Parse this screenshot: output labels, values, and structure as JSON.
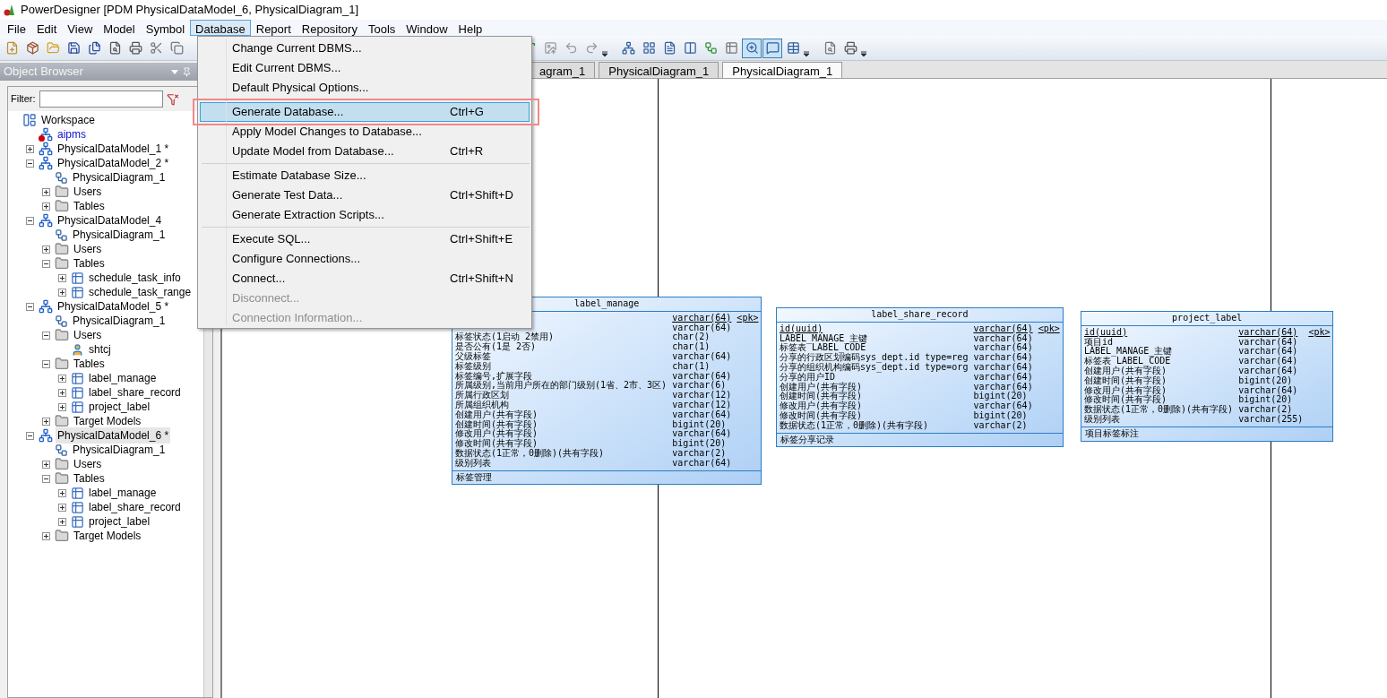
{
  "window": {
    "title": "PowerDesigner [PDM PhysicalDataModel_6, PhysicalDiagram_1]"
  },
  "menu_bar": [
    {
      "label": "File",
      "selected": false
    },
    {
      "label": "Edit",
      "selected": false
    },
    {
      "label": "View",
      "selected": false
    },
    {
      "label": "Model",
      "selected": false
    },
    {
      "label": "Symbol",
      "selected": false
    },
    {
      "label": "Database",
      "selected": true
    },
    {
      "label": "Report",
      "selected": false
    },
    {
      "label": "Repository",
      "selected": false
    },
    {
      "label": "Tools",
      "selected": false
    },
    {
      "label": "Window",
      "selected": false
    },
    {
      "label": "Help",
      "selected": false
    }
  ],
  "database_menu": [
    {
      "kind": "item",
      "label": "Change Current DBMS...",
      "disabled": false,
      "selected": false
    },
    {
      "kind": "item",
      "label": "Edit Current DBMS...",
      "disabled": false,
      "selected": false
    },
    {
      "kind": "item",
      "label": "Default Physical Options...",
      "disabled": false,
      "selected": false
    },
    {
      "kind": "separator"
    },
    {
      "kind": "item",
      "label": "Generate Database...",
      "shortcut": "Ctrl+G",
      "disabled": false,
      "selected": true
    },
    {
      "kind": "item",
      "label": "Apply Model Changes to Database...",
      "disabled": false,
      "selected": false
    },
    {
      "kind": "item",
      "label": "Update Model from Database...",
      "shortcut": "Ctrl+R",
      "disabled": false,
      "selected": false
    },
    {
      "kind": "separator"
    },
    {
      "kind": "item",
      "label": "Estimate Database Size...",
      "disabled": false,
      "selected": false
    },
    {
      "kind": "item",
      "label": "Generate Test Data...",
      "shortcut": "Ctrl+Shift+D",
      "disabled": false,
      "selected": false
    },
    {
      "kind": "item",
      "label": "Generate Extraction Scripts...",
      "disabled": false,
      "selected": false
    },
    {
      "kind": "separator"
    },
    {
      "kind": "item",
      "label": "Execute SQL...",
      "shortcut": "Ctrl+Shift+E",
      "disabled": false,
      "selected": false
    },
    {
      "kind": "item",
      "label": "Configure Connections...",
      "disabled": false,
      "selected": false
    },
    {
      "kind": "item",
      "label": "Connect...",
      "shortcut": "Ctrl+Shift+N",
      "disabled": false,
      "selected": false
    },
    {
      "kind": "item",
      "label": "Disconnect...",
      "disabled": true,
      "selected": false
    },
    {
      "kind": "item",
      "label": "Connection Information...",
      "disabled": true,
      "selected": false
    }
  ],
  "object_browser": {
    "title": "Object Browser",
    "filter_label": "Filter:",
    "tree": [
      {
        "label": "Workspace",
        "kind": "workspace",
        "selected": false,
        "children": [
          {
            "label": "aipms",
            "kind": "closed_model",
            "selected": false
          },
          {
            "label": "PhysicalDataModel_1 *",
            "kind": "model",
            "selected": false,
            "expanded": false
          },
          {
            "label": "PhysicalDataModel_2 *",
            "kind": "model",
            "selected": false,
            "expanded": true,
            "children": [
              {
                "label": "PhysicalDiagram_1",
                "kind": "diagram",
                "selected": false
              },
              {
                "label": "Users",
                "kind": "folder",
                "selected": false,
                "expanded": false
              },
              {
                "label": "Tables",
                "kind": "folder",
                "selected": false,
                "expanded": false
              }
            ]
          },
          {
            "label": "PhysicalDataModel_4",
            "kind": "model",
            "selected": false,
            "expanded": true,
            "children": [
              {
                "label": "PhysicalDiagram_1",
                "kind": "diagram",
                "selected": false
              },
              {
                "label": "Users",
                "kind": "folder",
                "selected": false,
                "expanded": false
              },
              {
                "label": "Tables",
                "kind": "folder",
                "selected": false,
                "expanded": true,
                "children": [
                  {
                    "label": "schedule_task_info",
                    "kind": "table",
                    "selected": false,
                    "expanded": false
                  },
                  {
                    "label": "schedule_task_range",
                    "kind": "table",
                    "selected": false,
                    "expanded": false
                  }
                ]
              }
            ]
          },
          {
            "label": "PhysicalDataModel_5 *",
            "kind": "model",
            "selected": false,
            "expanded": true,
            "children": [
              {
                "label": "PhysicalDiagram_1",
                "kind": "diagram",
                "selected": false
              },
              {
                "label": "Users",
                "kind": "folder",
                "selected": false,
                "expanded": true,
                "children": [
                  {
                    "label": "shtcj",
                    "kind": "user",
                    "selected": false
                  }
                ]
              },
              {
                "label": "Tables",
                "kind": "folder",
                "selected": false,
                "expanded": true,
                "children": [
                  {
                    "label": "label_manage",
                    "kind": "table",
                    "selected": false,
                    "expanded": false
                  },
                  {
                    "label": "label_share_record",
                    "kind": "table",
                    "selected": false,
                    "expanded": false
                  },
                  {
                    "label": "project_label",
                    "kind": "table",
                    "selected": false,
                    "expanded": false
                  }
                ]
              },
              {
                "label": "Target Models",
                "kind": "folder",
                "selected": false,
                "expanded": false
              }
            ]
          },
          {
            "label": "PhysicalDataModel_6 *",
            "kind": "model",
            "selected": true,
            "expanded": true,
            "children": [
              {
                "label": "PhysicalDiagram_1",
                "kind": "diagram",
                "selected": false
              },
              {
                "label": "Users",
                "kind": "folder",
                "selected": false,
                "expanded": false
              },
              {
                "label": "Tables",
                "kind": "folder",
                "selected": false,
                "expanded": true,
                "children": [
                  {
                    "label": "label_manage",
                    "kind": "table",
                    "selected": false,
                    "expanded": false
                  },
                  {
                    "label": "label_share_record",
                    "kind": "table",
                    "selected": false,
                    "expanded": false
                  },
                  {
                    "label": "project_label",
                    "kind": "table",
                    "selected": false,
                    "expanded": false
                  }
                ]
              },
              {
                "label": "Target Models",
                "kind": "folder",
                "selected": false,
                "expanded": false
              }
            ]
          }
        ]
      }
    ]
  },
  "diagram_tabs": [
    {
      "label": "agram_1",
      "selected": false
    },
    {
      "label": "PhysicalDiagram_1",
      "selected": false
    },
    {
      "label": "PhysicalDiagram_1",
      "selected": true
    }
  ],
  "entities": [
    {
      "name": "label_manage",
      "comment": "标签管理",
      "rows": [
        {
          "type": "varchar(64)",
          "key": "<pk>"
        },
        {
          "type": "varchar(64)"
        },
        {
          "name": "标签状态(1启动 2禁用)",
          "type": "char(2)"
        },
        {
          "name": "是否公有(1是 2否)",
          "type": "char(1)"
        },
        {
          "name": "父级标签",
          "type": "varchar(64)"
        },
        {
          "name": "标签级别",
          "type": "char(1)"
        },
        {
          "name": "标签编号,扩展字段",
          "type": "varchar(64)"
        },
        {
          "name": "所属级别,当前用户所在的部门级别(1省、2市、3区)",
          "type": "varchar(6)"
        },
        {
          "name": "所属行政区划",
          "type": "varchar(12)"
        },
        {
          "name": "所属组织机构",
          "type": "varchar(12)"
        },
        {
          "name": "创建用户(共有字段)",
          "type": "varchar(64)"
        },
        {
          "name": "创建时间(共有字段)",
          "type": "bigint(20)"
        },
        {
          "name": "修改用户(共有字段)",
          "type": "varchar(64)"
        },
        {
          "name": "修改时间(共有字段)",
          "type": "bigint(20)"
        },
        {
          "name": "数据状态(1正常，0删除)(共有字段)",
          "type": "varchar(2)"
        },
        {
          "name": "级别列表",
          "type": "varchar(64)"
        }
      ]
    },
    {
      "name": "label_share_record",
      "comment": "标签分享记录",
      "rows": [
        {
          "name": "id(uuid)",
          "type": "varchar(64)",
          "key": "<pk>"
        },
        {
          "name": "LABEL_MANAGE_主键",
          "type": "varchar(64)"
        },
        {
          "name": "标签表 LABEL_CODE",
          "type": "varchar(64)"
        },
        {
          "name": "分享的行政区划编码sys_dept.id type=reg",
          "type": "varchar(64)"
        },
        {
          "name": "分享的组织机构编码sys_dept.id type=org",
          "type": "varchar(64)"
        },
        {
          "name": "分享的用户ID",
          "type": "varchar(64)"
        },
        {
          "name": "创建用户(共有字段)",
          "type": "varchar(64)"
        },
        {
          "name": "创建时间(共有字段)",
          "type": "bigint(20)"
        },
        {
          "name": "修改用户(共有字段)",
          "type": "varchar(64)"
        },
        {
          "name": "修改时间(共有字段)",
          "type": "bigint(20)"
        },
        {
          "name": "数据状态(1正常，0删除)(共有字段)",
          "type": "varchar(2)"
        }
      ]
    },
    {
      "name": "project_label",
      "comment": "项目标签标注",
      "rows": [
        {
          "name": "id(uuid)",
          "type": "varchar(64)",
          "key": "<pk>"
        },
        {
          "name": "项目id",
          "type": "varchar(64)"
        },
        {
          "name": "LABEL_MANAGE_主键",
          "type": "varchar(64)"
        },
        {
          "name": "标签表 LABEL_CODE",
          "type": "varchar(64)"
        },
        {
          "name": "创建用户(共有字段)",
          "type": "varchar(64)"
        },
        {
          "name": "创建时间(共有字段)",
          "type": "bigint(20)"
        },
        {
          "name": "修改用户(共有字段)",
          "type": "varchar(64)"
        },
        {
          "name": "修改时间(共有字段)",
          "type": "bigint(20)"
        },
        {
          "name": "数据状态(1正常，0删除)(共有字段)",
          "type": "varchar(2)"
        },
        {
          "name": "级别列表",
          "type": "varchar(255)"
        }
      ]
    }
  ]
}
